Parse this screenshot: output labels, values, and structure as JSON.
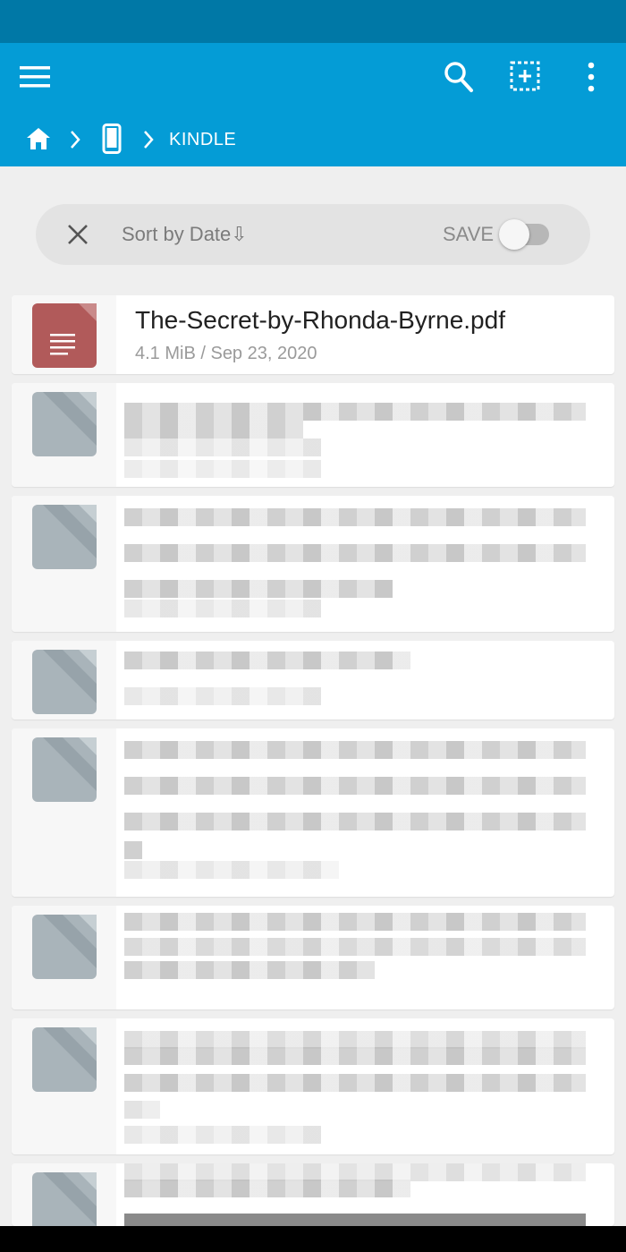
{
  "colors": {
    "status_bar": "#0078a6",
    "app_bar": "#049cd6",
    "background": "#efefef",
    "pdf_thumb": "#b15a5a",
    "generic_thumb": "#a9b4ba"
  },
  "header": {
    "menu_icon": "hamburger-menu-icon",
    "search_icon": "search-icon",
    "select_icon": "select-all-icon",
    "more_icon": "more-vert-icon"
  },
  "breadcrumb": {
    "home_icon": "home-icon",
    "device_icon": "smartphone-icon",
    "current": "KINDLE"
  },
  "sort_bar": {
    "label": "Sort by Date⇩",
    "save_label": "SAVE",
    "save_toggle_on": false
  },
  "files": [
    {
      "name": "The-Secret-by-Rhonda-Byrne.pdf",
      "meta": "4.1 MiB / Sep 23, 2020",
      "type": "pdf"
    }
  ]
}
